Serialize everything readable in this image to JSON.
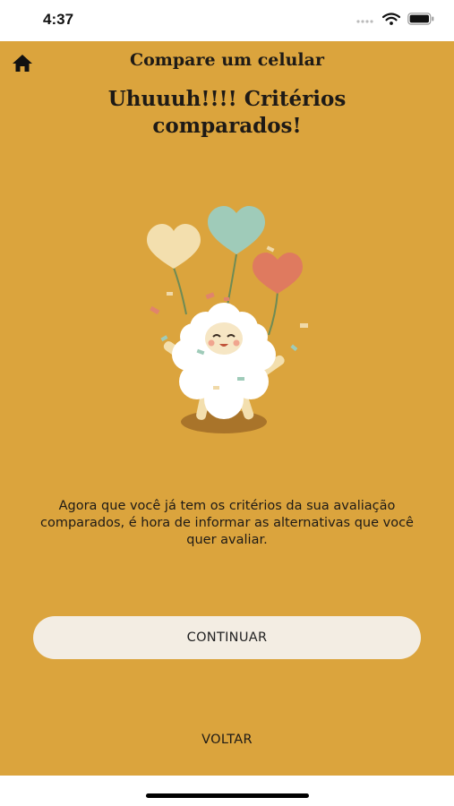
{
  "status_bar": {
    "time": "4:37"
  },
  "header": {
    "title": "Compare um celular",
    "home_icon": "home-icon"
  },
  "main": {
    "headline": "Uhuuuh!!!! Critérios comparados!",
    "illustration": "celebrating-sheep-with-heart-balloons",
    "description": "Agora que você já tem os critérios da sua avaliação comparados, é hora de informar as alternativas que você quer avaliar."
  },
  "actions": {
    "continue_label": "CONTINUAR",
    "back_label": "VOLTAR"
  },
  "colors": {
    "background": "#dba43d",
    "button": "#f3ede3",
    "text": "#1e1a16"
  }
}
